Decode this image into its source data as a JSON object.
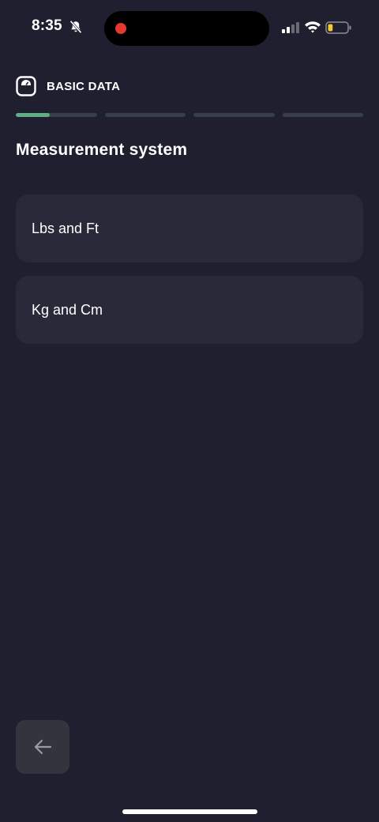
{
  "status_bar": {
    "time": "8:35",
    "icons": [
      "bell-slash-icon",
      "recording-dot-icon",
      "cellular-signal-icon",
      "wifi-icon",
      "battery-low-icon"
    ],
    "battery_level": 0.25,
    "battery_color": "#f5c92f",
    "recording_color": "#e5392f"
  },
  "header": {
    "icon": "scale-icon",
    "label": "BASIC DATA"
  },
  "progress": {
    "steps_total": 4,
    "current_step": 1,
    "current_step_fill": 0.42,
    "accent_color": "#5fae86"
  },
  "page": {
    "title": "Measurement system"
  },
  "options": [
    {
      "label": "Lbs and Ft"
    },
    {
      "label": "Kg and Cm"
    }
  ],
  "navigation": {
    "back_icon": "arrow-left-icon"
  },
  "theme": {
    "background": "#1f1f2f",
    "card": "#29293a"
  }
}
